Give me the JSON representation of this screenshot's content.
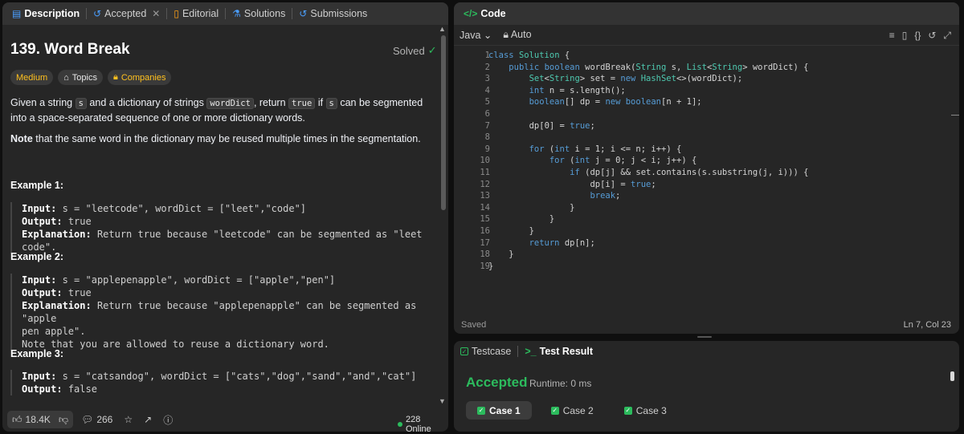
{
  "left_tabs": [
    {
      "label": "Description",
      "icon": "document-icon",
      "active": true
    },
    {
      "label": "Accepted",
      "icon": "history-icon",
      "active": false,
      "closable": true
    },
    {
      "label": "Editorial",
      "icon": "book-icon",
      "active": false
    },
    {
      "label": "Solutions",
      "icon": "flask-icon",
      "active": false
    },
    {
      "label": "Submissions",
      "icon": "history-icon",
      "active": false
    }
  ],
  "problem": {
    "title": "139. Word Break",
    "status": "Solved",
    "difficulty": "Medium",
    "topics_label": "Topics",
    "companies_label": "Companies",
    "desc_1": "Given a string",
    "code_s": "s",
    "desc_2": "and a dictionary of strings",
    "code_worddict": "wordDict",
    "desc_3": ", return",
    "code_true": "true",
    "desc_4": "if",
    "desc_5": "can be segmented into a space-separated sequence of one or more dictionary words.",
    "note_bold": "Note",
    "note_rest": "that the same word in the dictionary may be reused multiple times in the segmentation."
  },
  "examples": [
    {
      "heading": "Example 1:",
      "input_label": "Input:",
      "input": "s = \"leetcode\", wordDict = [\"leet\",\"code\"]",
      "output_label": "Output:",
      "output": "true",
      "explanation_label": "Explanation:",
      "explanation": "Return true because \"leetcode\" can be segmented as \"leet code\"."
    },
    {
      "heading": "Example 2:",
      "input_label": "Input:",
      "input": "s = \"applepenapple\", wordDict = [\"apple\",\"pen\"]",
      "output_label": "Output:",
      "output": "true",
      "explanation_label": "Explanation:",
      "explanation_l1": "Return true because \"applepenapple\" can be segmented as \"apple",
      "explanation_l2": "pen apple\".",
      "note": "Note that you are allowed to reuse a dictionary word."
    },
    {
      "heading": "Example 3:",
      "input_label": "Input:",
      "input": "s = \"catsandog\", wordDict = [\"cats\",\"dog\",\"sand\",\"and\",\"cat\"]",
      "output_label": "Output:",
      "output": "false"
    }
  ],
  "footer": {
    "likes": "18.4K",
    "comments": "266",
    "online": "228 Online"
  },
  "code_panel": {
    "title": "Code",
    "language": "Java",
    "mode": "Auto",
    "saved": "Saved",
    "cursor": "Ln 7, Col 23",
    "line_numbers": [
      "1",
      "2",
      "3",
      "4",
      "5",
      "6",
      "7",
      "8",
      "9",
      "10",
      "11",
      "12",
      "13",
      "14",
      "15",
      "16",
      "17",
      "18",
      "19"
    ],
    "lines": [
      "class Solution {",
      "    public boolean wordBreak(String s, List<String> wordDict) {",
      "        Set<String> set = new HashSet<>(wordDict);",
      "        int n = s.length();",
      "        boolean[] dp = new boolean[n + 1];",
      "",
      "        dp[0] = true;",
      "",
      "        for (int i = 1; i <= n; i++) {",
      "            for (int j = 0; j < i; j++) {",
      "                if (dp[j] && set.contains(s.substring(j, i))) {",
      "                    dp[i] = true;",
      "                    break;",
      "                }",
      "            }",
      "        }",
      "        return dp[n];",
      "    }",
      "}"
    ]
  },
  "test_panel": {
    "testcase_tab": "Testcase",
    "result_tab": "Test Result",
    "verdict": "Accepted",
    "runtime": "Runtime: 0 ms",
    "cases": [
      "Case 1",
      "Case 2",
      "Case 3"
    ]
  },
  "colors": {
    "accent_green": "#2cbb5d",
    "medium_yellow": "#ffc01e",
    "blue": "#4a9eff"
  }
}
